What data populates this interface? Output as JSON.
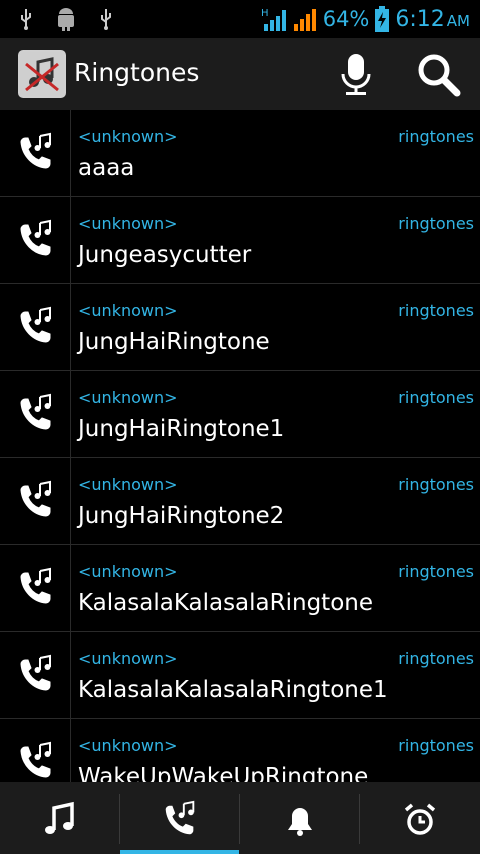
{
  "status_bar": {
    "battery_percent": "64%",
    "time": "6:12",
    "ampm": "AM",
    "network_type": "H",
    "icons": [
      "usb-icon",
      "android-debug-icon",
      "usb-icon",
      "signal-icon",
      "battery-charging-icon"
    ]
  },
  "action_bar": {
    "title": "Ringtones",
    "icons": [
      "app-icon",
      "microphone-icon",
      "search-icon"
    ]
  },
  "list": {
    "items": [
      {
        "artist": "<unknown>",
        "category": "ringtones",
        "title": "aaaa"
      },
      {
        "artist": "<unknown>",
        "category": "ringtones",
        "title": "Jungeasycutter"
      },
      {
        "artist": "<unknown>",
        "category": "ringtones",
        "title": "JungHaiRingtone"
      },
      {
        "artist": "<unknown>",
        "category": "ringtones",
        "title": "JungHaiRingtone1"
      },
      {
        "artist": "<unknown>",
        "category": "ringtones",
        "title": "JungHaiRingtone2"
      },
      {
        "artist": "<unknown>",
        "category": "ringtones",
        "title": "KalasalaKalasalaRingtone"
      },
      {
        "artist": "<unknown>",
        "category": "ringtones",
        "title": "KalasalaKalasalaRingtone1"
      },
      {
        "artist": "<unknown>",
        "category": "ringtones",
        "title": "WakeUpWakeUpRingtone"
      }
    ]
  },
  "tabs": [
    {
      "icon": "music-note-icon",
      "selected": false
    },
    {
      "icon": "phone-music-icon",
      "selected": true
    },
    {
      "icon": "bell-icon",
      "selected": false
    },
    {
      "icon": "alarm-clock-icon",
      "selected": false
    }
  ],
  "colors": {
    "accent": "#33b5e5",
    "background": "#000000",
    "bar": "#1c1c1c"
  }
}
